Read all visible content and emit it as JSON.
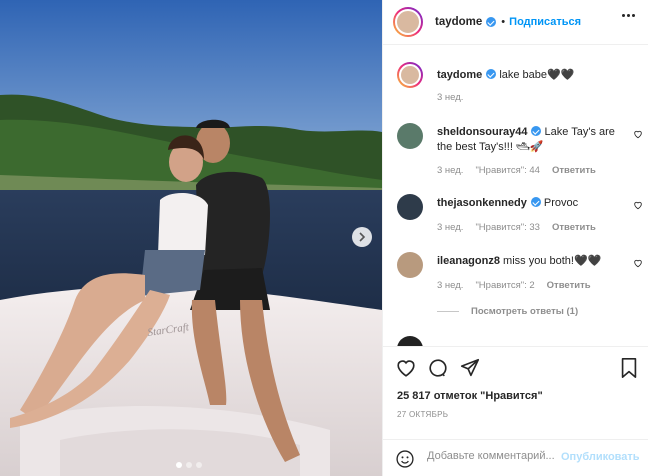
{
  "header": {
    "username": "taydome",
    "follow_label": "Подписаться"
  },
  "caption": {
    "username": "taydome",
    "text": "lake babe🖤🖤",
    "time": "3 нед."
  },
  "comments": [
    {
      "username": "sheldonsouray44",
      "verified": true,
      "text": "Lake Tay's are the best Tay's!!! 🛥🚀",
      "time": "3 нед.",
      "likes": "\"Нравится\": 44",
      "reply": "Ответить"
    },
    {
      "username": "thejasonkennedy",
      "verified": true,
      "text": "Provoc",
      "time": "3 нед.",
      "likes": "\"Нравится\": 33",
      "reply": "Ответить"
    },
    {
      "username": "ileanagonz8",
      "verified": false,
      "text": "miss you both!🖤🖤",
      "time": "3 нед.",
      "likes": "\"Нравится\": 2",
      "reply": "Ответить",
      "view_replies": "Посмотреть ответы (1)"
    }
  ],
  "actions": {
    "likes_count": "25 817 отметок \"Нравится\"",
    "date": "27 ОКТЯБРЬ"
  },
  "add_comment": {
    "placeholder": "Добавьте комментарий...",
    "publish_label": "Опубликовать"
  },
  "photo": {
    "boat_brand": "StarCraft",
    "slide_index": 1,
    "slide_count": 3
  }
}
